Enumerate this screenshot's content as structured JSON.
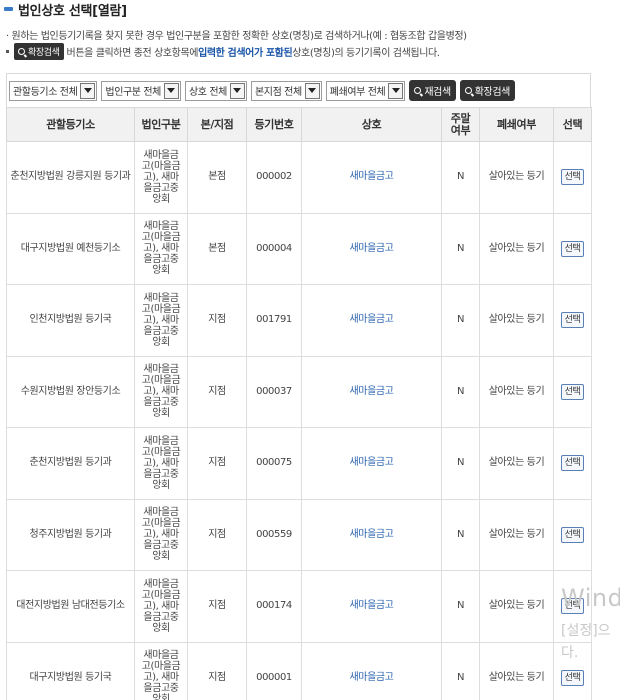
{
  "header": {
    "title": "법인상호 선택[열람]"
  },
  "info": {
    "line1": "· 원하는 법인등기기록을 찾지 못한 경우 법인구분을 포함한 정확한 상호(명칭)로 검색하거나(예 : 협동조합 갑을병정)",
    "btn_label": "확장검색",
    "line2_a": " 버튼을 클릭하면 종전 상호항목에 ",
    "line2_hl": "입력한 검색어가 포함된",
    "line2_b": " 상호(명칭)의 등기기록이 검색됩니다."
  },
  "filters": {
    "court": "관할등기소 전체",
    "type": "법인구분 전체",
    "trade": "상호 전체",
    "branch": "본지점 전체",
    "closed": "폐쇄여부 전체",
    "research": "재검색",
    "expand": "확장검색"
  },
  "table": {
    "headers": {
      "court": "관할등기소",
      "type": "법인구분",
      "branch": "본/지점",
      "regno": "등기번호",
      "name": "상호",
      "main_l1": "주말",
      "main_l2": "여부",
      "closed": "폐쇄여부",
      "select": "선택"
    },
    "type_l1": "새마을금",
    "type_l2": "고(마을금",
    "type_l3": "고), 새마",
    "type_l4": "을금고중",
    "type_l5": "앙회",
    "rows": [
      {
        "court": "춘천지방법원 강릉지원 등기과",
        "branch": "본점",
        "regno": "000002",
        "name": "새마을금고",
        "main": "N",
        "closed": "살아있는 등기",
        "select": "선택"
      },
      {
        "court": "대구지방법원 예천등기소",
        "branch": "본점",
        "regno": "000004",
        "name": "새마을금고",
        "main": "N",
        "closed": "살아있는 등기",
        "select": "선택"
      },
      {
        "court": "인천지방법원 등기국",
        "branch": "지점",
        "regno": "001791",
        "name": "새마을금고",
        "main": "N",
        "closed": "살아있는 등기",
        "select": "선택"
      },
      {
        "court": "수원지방법원 장안등기소",
        "branch": "지점",
        "regno": "000037",
        "name": "새마을금고",
        "main": "N",
        "closed": "살아있는 등기",
        "select": "선택"
      },
      {
        "court": "춘천지방법원 등기과",
        "branch": "지점",
        "regno": "000075",
        "name": "새마을금고",
        "main": "N",
        "closed": "살아있는 등기",
        "select": "선택"
      },
      {
        "court": "청주지방법원 등기과",
        "branch": "지점",
        "regno": "000559",
        "name": "새마을금고",
        "main": "N",
        "closed": "살아있는 등기",
        "select": "선택"
      },
      {
        "court": "대전지방법원 남대전등기소",
        "branch": "지점",
        "regno": "000174",
        "name": "새마을금고",
        "main": "N",
        "closed": "살아있는 등기",
        "select": "선택"
      },
      {
        "court": "대구지방법원 등기국",
        "branch": "지점",
        "regno": "000001",
        "name": "새마을금고",
        "main": "N",
        "closed": "살아있는 등기",
        "select": "선택"
      }
    ]
  },
  "watermark": {
    "line1": "Wind",
    "line2": "[설정]으",
    "line3": "다."
  }
}
